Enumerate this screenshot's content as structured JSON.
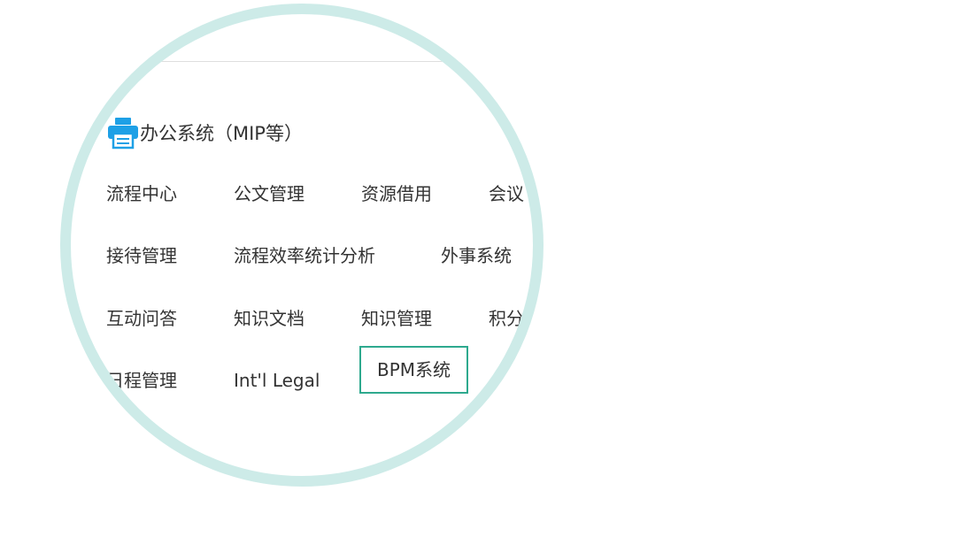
{
  "section": {
    "title": "办公系统（MIP等）",
    "icon": "printer-icon"
  },
  "colors": {
    "ring": "#cdebe8",
    "icon": "#1ea0e6",
    "selected_border": "#2ea98e",
    "text": "#333333"
  },
  "items": [
    {
      "label": "流程中心"
    },
    {
      "label": "公文管理"
    },
    {
      "label": "资源借用"
    },
    {
      "label": "会议"
    },
    {
      "label": "接待管理"
    },
    {
      "label": "流程效率统计分析"
    },
    {
      "label": "外事系统"
    },
    {
      "label": "互动问答"
    },
    {
      "label": "知识文档"
    },
    {
      "label": "知识管理"
    },
    {
      "label": "积分"
    },
    {
      "label": "日程管理"
    },
    {
      "label": "Int'l Legal"
    },
    {
      "label": "BPM系统",
      "selected": true
    }
  ]
}
